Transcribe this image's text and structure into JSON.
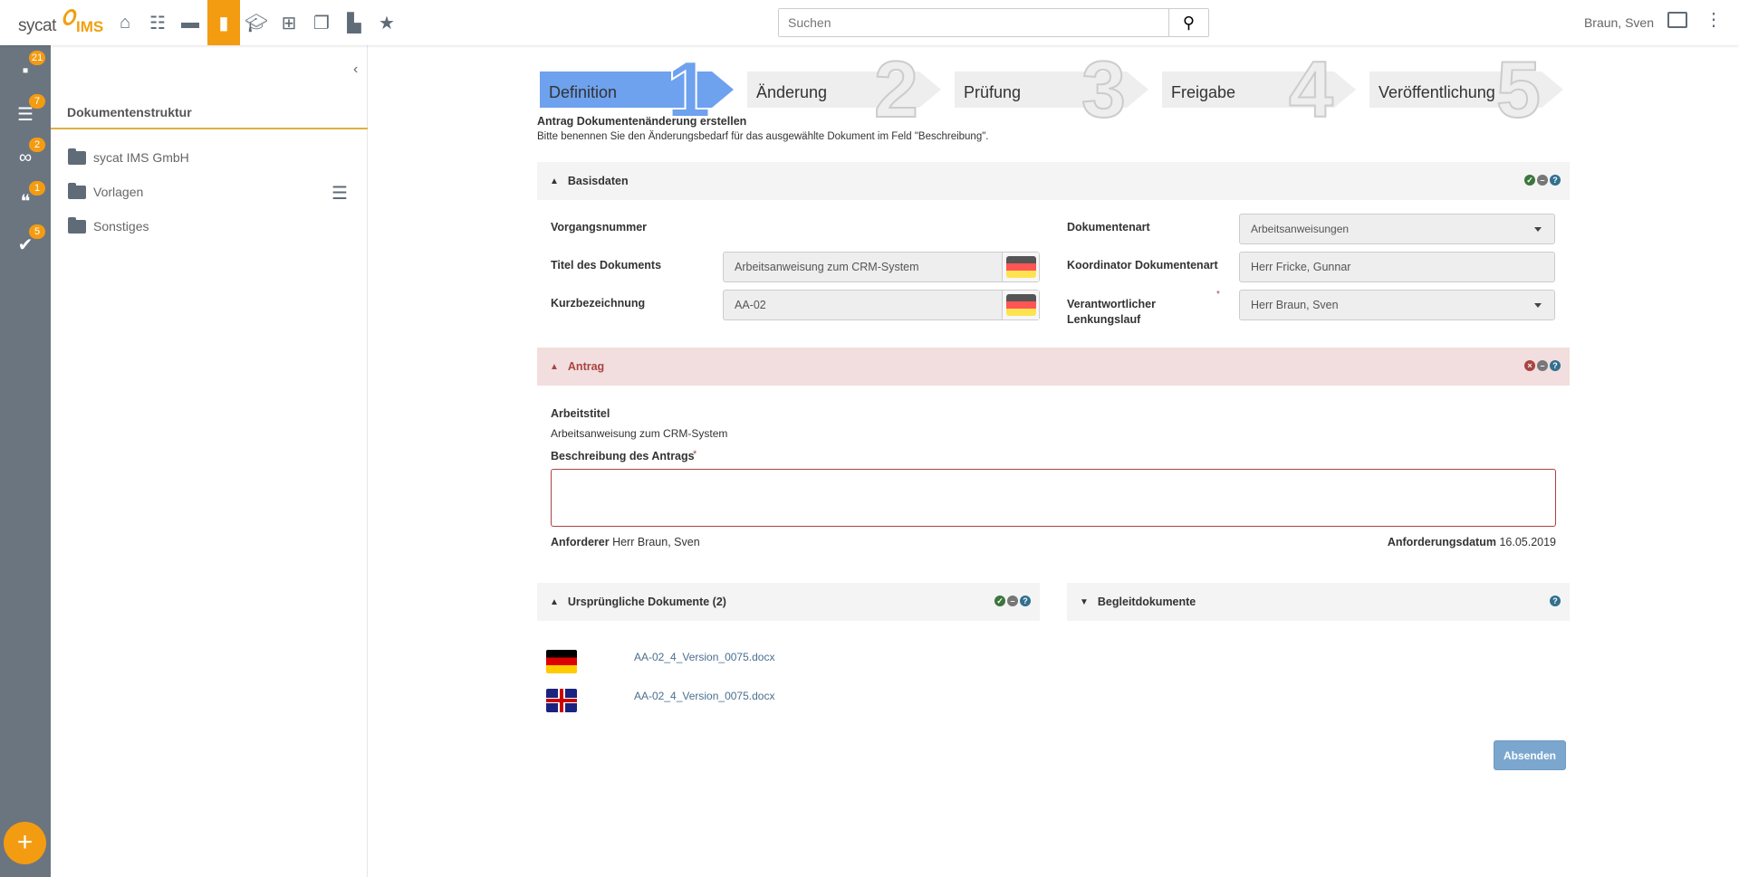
{
  "header": {
    "logo_text": "sycat",
    "logo_accent": "IMS",
    "search_placeholder": "Suchen",
    "user": "Braun, Sven",
    "nav": [
      "home-icon",
      "tasks-icon",
      "process-icon",
      "document-icon",
      "training-icon",
      "org-chart-icon",
      "copies-icon",
      "chart-icon",
      "star-icon"
    ]
  },
  "sidebar": {
    "items": [
      {
        "icon": "document-gear-icon",
        "badge": "21"
      },
      {
        "icon": "checklist-icon",
        "badge": "7"
      },
      {
        "icon": "glasses-icon",
        "badge": "2"
      },
      {
        "icon": "thumbs-icon",
        "badge": "1"
      },
      {
        "icon": "approve-icon",
        "badge": "5"
      }
    ],
    "add": "+"
  },
  "tree": {
    "title": "Dokumentenstruktur",
    "items": [
      "sycat IMS GmbH",
      "Vorlagen",
      "Sonstiges"
    ]
  },
  "wizard": {
    "steps": [
      {
        "label": "Definition",
        "num": "1"
      },
      {
        "label": "Änderung",
        "num": "2"
      },
      {
        "label": "Prüfung",
        "num": "3"
      },
      {
        "label": "Freigabe",
        "num": "4"
      },
      {
        "label": "Veröffentlichung",
        "num": "5"
      }
    ]
  },
  "intro": {
    "title": "Antrag Dokumentenänderung erstellen",
    "text": "Bitte benennen Sie den Änderungsbedarf für das ausgewählte Dokument im Feld \"Beschreibung\"."
  },
  "basis": {
    "title": "Basisdaten",
    "vorgang_label": "Vorgangsnummer",
    "titel_label": "Titel des Dokuments",
    "titel_value": "Arbeitsanweisung zum CRM-System",
    "kurz_label": "Kurzbezeichnung",
    "kurz_value": "AA-02",
    "art_label": "Dokumentenart",
    "art_value": "Arbeitsanweisungen",
    "koord_label": "Koordinator Dokumentenart",
    "koord_value": "Herr Fricke, Gunnar",
    "lenk_label": "Verantwortlicher Lenkungslauf",
    "lenk_value": "Herr Braun, Sven",
    "required": "*"
  },
  "antrag": {
    "title": "Antrag",
    "arbeitstitel_label": "Arbeitstitel",
    "arbeitstitel_value": "Arbeitsanweisung zum CRM-System",
    "beschreibung_label": "Beschreibung des Antrags",
    "required": "*",
    "beschreibung_value": "",
    "anforderer_label": "Anforderer",
    "anforderer_value": "Herr Braun, Sven",
    "datum_label": "Anforderungsdatum",
    "datum_value": "16.05.2019"
  },
  "docs": {
    "orig_title": "Ursprüngliche Dokumente (2)",
    "beg_title": "Begleitdokumente",
    "files": [
      {
        "lang": "de",
        "name": "AA-02_4_Version_0075.docx"
      },
      {
        "lang": "en",
        "name": "AA-02_4_Version_0075.docx"
      }
    ]
  },
  "submit": "Absenden",
  "colors": {
    "accent": "#f39c12",
    "step_active": "#6ea1ee",
    "error": "#a94442",
    "submit": "#7ba7cf"
  }
}
